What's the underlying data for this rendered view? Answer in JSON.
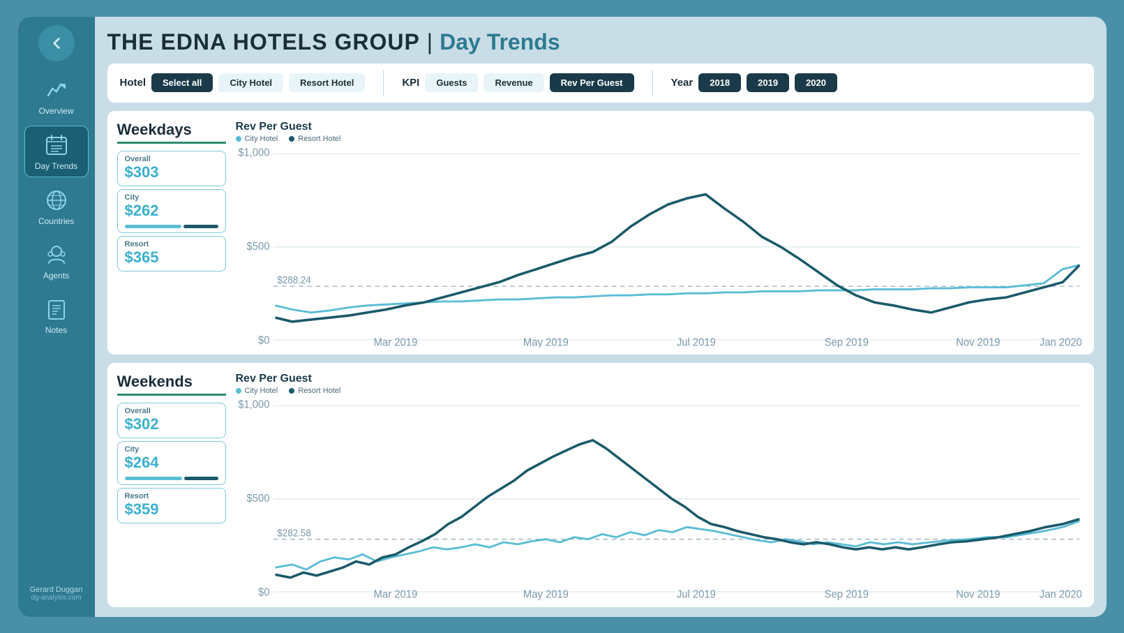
{
  "app": {
    "title_brand": "THE EDNA HOTELS GROUP",
    "title_section": "Day Trends"
  },
  "sidebar": {
    "back_label": "back",
    "items": [
      {
        "id": "overview",
        "label": "Overview",
        "active": false
      },
      {
        "id": "day-trends",
        "label": "Day Trends",
        "active": true
      },
      {
        "id": "countries",
        "label": "Countries",
        "active": false
      },
      {
        "id": "agents",
        "label": "Agents",
        "active": false
      },
      {
        "id": "notes",
        "label": "Notes",
        "active": false
      }
    ],
    "user_name": "Gerard Duggan",
    "user_site": "dg-analysis.com"
  },
  "filters": {
    "hotel_label": "Hotel",
    "hotel_buttons": [
      {
        "id": "select-all",
        "label": "Select all",
        "active": true
      },
      {
        "id": "city-hotel",
        "label": "City Hotel",
        "active": false
      },
      {
        "id": "resort-hotel",
        "label": "Resort Hotel",
        "active": false
      }
    ],
    "kpi_label": "KPI",
    "kpi_buttons": [
      {
        "id": "guests",
        "label": "Guests",
        "active": false
      },
      {
        "id": "revenue",
        "label": "Revenue",
        "active": false
      },
      {
        "id": "rev-per-guest",
        "label": "Rev Per Guest",
        "active": true
      }
    ],
    "year_label": "Year",
    "year_buttons": [
      {
        "id": "2018",
        "label": "2018",
        "active": true
      },
      {
        "id": "2019",
        "label": "2019",
        "active": true
      },
      {
        "id": "2020",
        "label": "2020",
        "active": true
      }
    ]
  },
  "weekdays": {
    "title": "Weekdays",
    "chart_title": "Rev Per Guest",
    "legend_city": "City Hotel",
    "legend_resort": "Resort Hotel",
    "overall_label": "Overall",
    "overall_value": "$303",
    "city_label": "City",
    "city_value": "$262",
    "city_bar_pct": 62,
    "city_bar_color": "#5bbdd6",
    "city_bar_dark_color": "#1a5a6a",
    "resort_label": "Resort",
    "resort_value": "$365",
    "avg_line_value": "$288.24",
    "y_max": "$1,000",
    "y_mid": "$500",
    "y_min": "$0",
    "x_labels": [
      "Mar 2019",
      "May 2019",
      "Jul 2019",
      "Sep 2019",
      "Nov 2019",
      "Jan 2020"
    ]
  },
  "weekends": {
    "title": "Weekends",
    "chart_title": "Rev Per Guest",
    "legend_city": "City Hotel",
    "legend_resort": "Resort Hotel",
    "overall_label": "Overall",
    "overall_value": "$302",
    "city_label": "City",
    "city_value": "$264",
    "city_bar_pct": 63,
    "city_bar_color": "#5bbdd6",
    "city_bar_dark_color": "#1a5a6a",
    "resort_label": "Resort",
    "resort_value": "$359",
    "avg_line_value": "$282.58",
    "y_max": "$1,000",
    "y_mid": "$500",
    "y_min": "$0",
    "x_labels": [
      "Mar 2019",
      "May 2019",
      "Jul 2019",
      "Sep 2019",
      "Nov 2019",
      "Jan 2020"
    ]
  }
}
